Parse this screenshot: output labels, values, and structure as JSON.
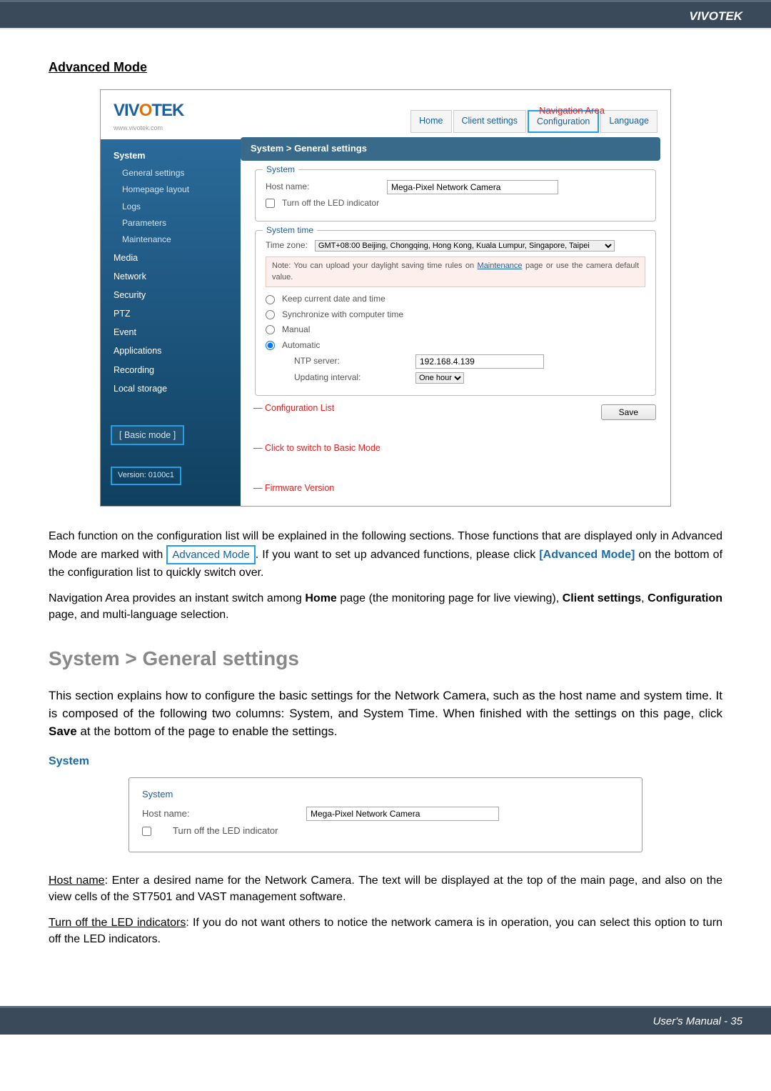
{
  "header_brand": "VIVOTEK",
  "section_title": "Advanced Mode",
  "screenshot": {
    "logo_prefix": "VIV",
    "logo_eye": "O",
    "logo_suffix": "TEK",
    "logo_sub": "www.vivotek.com",
    "nav": {
      "home": "Home",
      "client": "Client settings",
      "config": "Configuration",
      "lang": "Language"
    },
    "annot_nav": "Navigation Area",
    "crumb": "System  >  General settings",
    "sidebar": {
      "groups": [
        "System",
        "Media",
        "Network",
        "Security",
        "PTZ",
        "Event",
        "Applications",
        "Recording",
        "Local storage"
      ],
      "subs": [
        "General settings",
        "Homepage layout",
        "Logs",
        "Parameters",
        "Maintenance"
      ],
      "basic": "[ Basic mode ]",
      "version": "Version: 0100c1"
    },
    "main": {
      "fs1": {
        "legend": "System",
        "hostname_label": "Host name:",
        "hostname_value": "Mega-Pixel Network Camera",
        "led_label": "Turn off the LED indicator"
      },
      "fs2": {
        "legend": "System time",
        "tz_label": "Time zone:",
        "tz_value": "GMT+08:00 Beijing, Chongqing, Hong Kong, Kuala Lumpur, Singapore, Taipei",
        "note_prefix": "Note: You can upload your daylight saving time rules on ",
        "note_link": "Maintenance",
        "note_suffix": " page or use the camera default value.",
        "opt_keep": "Keep current date and time",
        "opt_sync": "Synchronize with computer time",
        "opt_manual": "Manual",
        "opt_auto": "Automatic",
        "ntp_label": "NTP server:",
        "ntp_value": "192.168.4.139",
        "upd_label": "Updating interval:",
        "upd_value": "One hour"
      },
      "save": "Save"
    },
    "annots": {
      "cfg": "Configuration List",
      "basic": "Click to switch to Basic Mode",
      "version": "Firmware Version"
    }
  },
  "body": {
    "p1a": "Each function on the configuration list will be explained in the following sections. Those functions that are displayed only in Advanced Mode are marked with ",
    "p1_badge": "Advanced Mode",
    "p1b": ". If you want to set up advanced functions, please click ",
    "p1_link": "[Advanced Mode]",
    "p1c": " on the bottom of the configuration list to quickly switch over.",
    "p2a": "Navigation Area provides an instant switch among ",
    "p2_b1": "Home",
    "p2b": " page (the monitoring page for live viewing), ",
    "p2_b2": "Client settings",
    "p2c": ", ",
    "p2_b3": "Configuration",
    "p2d": " page, and multi-language selection.",
    "h2": "System > General settings",
    "p3a": "This section explains how to configure the basic settings for the Network Camera, such as the host name and system time. It is composed of the following two columns: System, and System Time. When finished with the settings on this page, click ",
    "p3_b1": "Save",
    "p3b": " at the bottom of the page to enable the settings.",
    "subhead": "System",
    "block": {
      "legend": "System",
      "hostname_label": "Host name:",
      "hostname_value": "Mega-Pixel Network Camera",
      "led_label": "Turn off the LED indicator"
    },
    "hn_u": "Host name",
    "p4": ": Enter a desired name for the Network Camera. The text will be displayed at the top of the main page, and also on the view cells of the ST7501 and VAST management software.",
    "led_u": "Turn off the LED indicators",
    "p5": ": If you do not want others to notice the network camera is in operation, you can select this option to turn off the LED indicators."
  },
  "footer": {
    "text": "User's Manual - 35"
  }
}
